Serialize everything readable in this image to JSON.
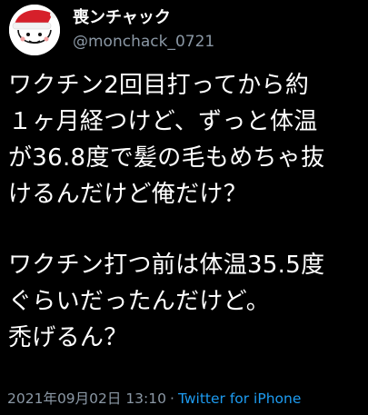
{
  "author": {
    "display_name": "喪ンチャック",
    "handle": "@monchack_0721",
    "avatar_icon": "santa-hat-cartoon-avatar"
  },
  "tweet": {
    "lines": [
      "ワクチン2回目打ってから約",
      "１ヶ月経つけど、ずっと体温",
      "が36.8度で髪の毛もめちゃ抜",
      "けるんだけど俺だけ？",
      "ワクチン打つ前は体温35.5度",
      "ぐらいだったんだけど。",
      "禿げるん？"
    ]
  },
  "meta": {
    "timestamp": "2021年09月02日 13:10",
    "separator": "·",
    "source": "Twitter for iPhone"
  },
  "colors": {
    "background": "#000000",
    "text": "#ffffff",
    "secondary": "#8b98a5",
    "link": "#1d9bf0"
  }
}
